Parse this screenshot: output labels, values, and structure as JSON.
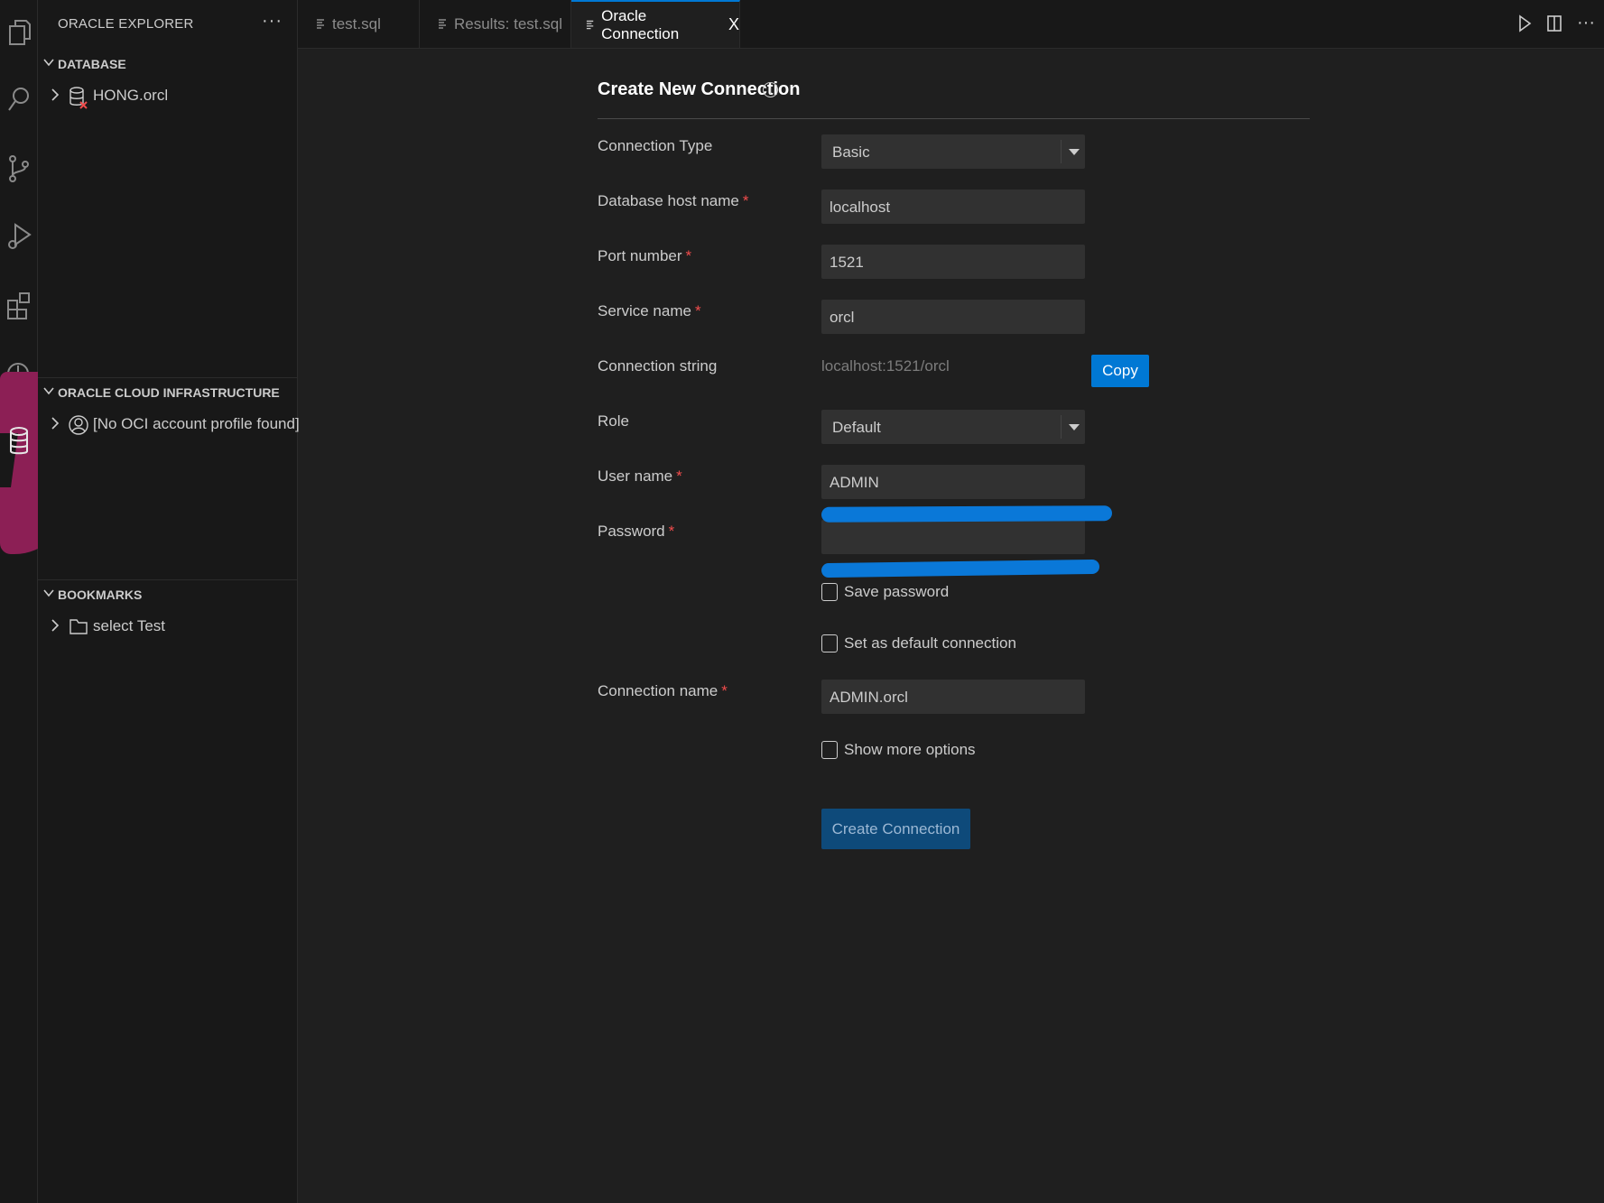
{
  "sidebar": {
    "title": "ORACLE EXPLORER",
    "more": "···",
    "sections": {
      "database": {
        "label": "DATABASE",
        "items": [
          {
            "label": "HONG.orcl",
            "icon": "database-error-icon"
          }
        ]
      },
      "oci": {
        "label": "ORACLE CLOUD INFRASTRUCTURE",
        "items": [
          {
            "label": "[No OCI account profile found]",
            "icon": "account-icon"
          }
        ]
      },
      "bookmarks": {
        "label": "BOOKMARKS",
        "items": [
          {
            "label": "select Test",
            "icon": "folder-icon"
          }
        ]
      }
    }
  },
  "tabs": [
    {
      "label": "test.sql",
      "active": false
    },
    {
      "label": "Results: test.sql",
      "active": false
    },
    {
      "label": "Oracle Connection",
      "active": true,
      "close": "X"
    }
  ],
  "form": {
    "title": "Create New Connection",
    "info_glyph": "i",
    "required_mark": "*",
    "fields": {
      "connection_type": {
        "label": "Connection Type",
        "value": "Basic"
      },
      "host": {
        "label": "Database host name",
        "value": "localhost"
      },
      "port": {
        "label": "Port number",
        "value": "1521"
      },
      "service": {
        "label": "Service name",
        "value": "orcl"
      },
      "connection_string": {
        "label": "Connection string",
        "value": "localhost:1521/orcl"
      },
      "role": {
        "label": "Role",
        "value": "Default"
      },
      "username": {
        "label": "User name",
        "value": "ADMIN"
      },
      "password": {
        "label": "Password",
        "value": ""
      },
      "connection_name": {
        "label": "Connection name",
        "value": "ADMIN.orcl"
      }
    },
    "copy_label": "Copy",
    "checkboxes": {
      "save_password": {
        "label": "Save password",
        "checked": false
      },
      "default_connection": {
        "label": "Set as default connection",
        "checked": false
      },
      "more_options": {
        "label": "Show more options",
        "checked": false
      }
    },
    "create_label": "Create Connection"
  },
  "colors": {
    "background": "#1f1f1f",
    "sidebar": "#181818",
    "accent": "#0078d4",
    "required": "#f14c4c",
    "annotation_pink": "#8c1f55",
    "annotation_blue": "#0a78d8"
  }
}
